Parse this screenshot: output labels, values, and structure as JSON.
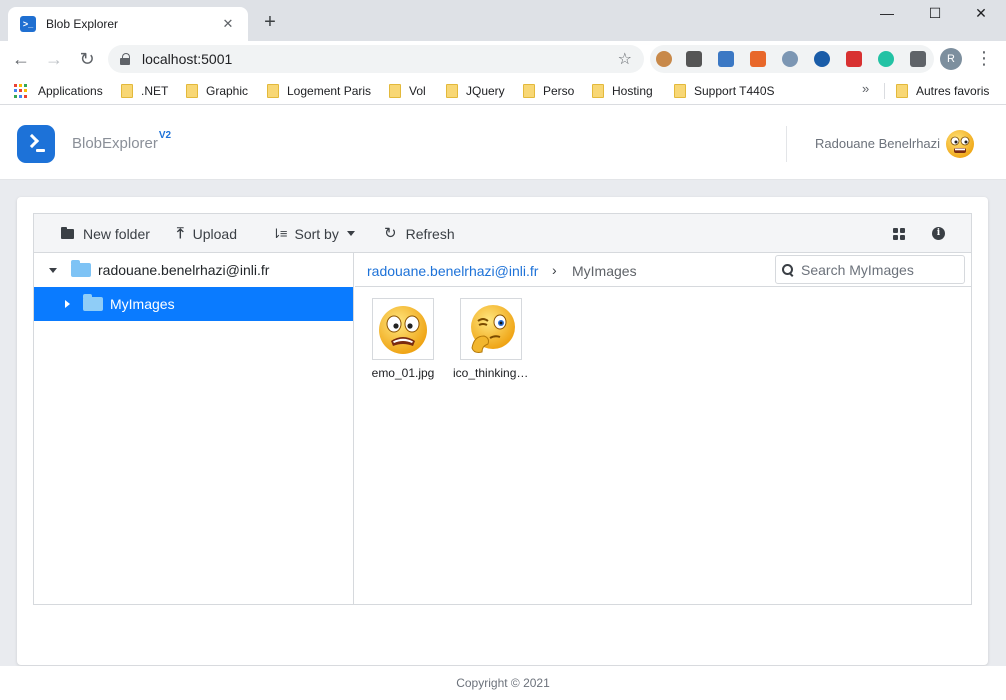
{
  "browser": {
    "tab_title": "Blob Explorer",
    "url": "localhost:5001",
    "profile_initial": "R",
    "bookmarks": [
      {
        "label": "Applications",
        "type": "apps"
      },
      {
        "label": ".NET",
        "type": "folder"
      },
      {
        "label": "Graphic",
        "type": "folder"
      },
      {
        "label": "Logement Paris",
        "type": "folder"
      },
      {
        "label": "Vol",
        "type": "folder"
      },
      {
        "label": "JQuery",
        "type": "folder"
      },
      {
        "label": "Perso",
        "type": "folder"
      },
      {
        "label": "Hosting",
        "type": "folder"
      },
      {
        "label": "Support T440S",
        "type": "folder"
      }
    ],
    "overflow_label": "»",
    "other_bookmarks": "Autres favoris"
  },
  "app": {
    "brand": "BlobExplorer",
    "brand_version": "V2",
    "user_name": "Radouane Benelrhazi",
    "footer": "Copyright © 2021"
  },
  "toolbar": {
    "new_folder": "New folder",
    "upload": "Upload",
    "sort_by": "Sort by",
    "refresh": "Refresh"
  },
  "tree": {
    "root": "radouane.benelrhazi@inli.fr",
    "child": "MyImages"
  },
  "breadcrumb": {
    "root": "radouane.benelrhazi@inli.fr",
    "separator": "›",
    "current": "MyImages"
  },
  "search": {
    "placeholder": "Search MyImages"
  },
  "files": [
    {
      "name": "emo_01.jpg",
      "icon": "scared-emoji"
    },
    {
      "name": "ico_thinking.jpg",
      "icon": "thinking-emoji"
    }
  ],
  "colors": {
    "accent": "#0a7bff",
    "brand": "#1d72d8",
    "folder": "#7ec3f5"
  }
}
